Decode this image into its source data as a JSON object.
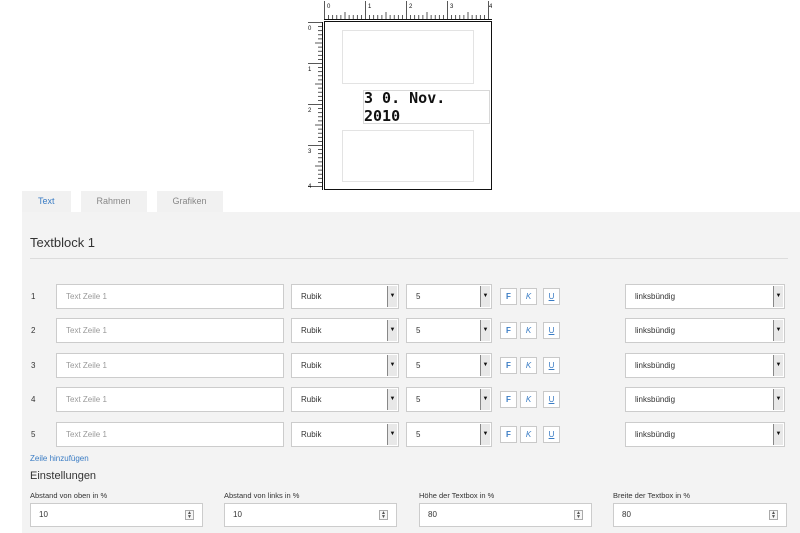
{
  "preview": {
    "ruler_top_labels": [
      "0",
      "1",
      "2",
      "3",
      "4"
    ],
    "ruler_left_labels": [
      "0",
      "1",
      "2",
      "3",
      "4"
    ],
    "stamp_text": "3 0. Nov. 2010"
  },
  "tabs": [
    {
      "label": "Text",
      "active": true
    },
    {
      "label": "Rahmen",
      "active": false
    },
    {
      "label": "Grafiken",
      "active": false
    }
  ],
  "textblock": {
    "title": "Textblock 1",
    "rows": [
      {
        "num": "1",
        "placeholder": "Text Zeile 1",
        "font": "Rubik",
        "size": "5",
        "bold": "F",
        "italic": "K",
        "underline": "U",
        "align": "linksbündig"
      },
      {
        "num": "2",
        "placeholder": "Text Zeile 1",
        "font": "Rubik",
        "size": "5",
        "bold": "F",
        "italic": "K",
        "underline": "U",
        "align": "linksbündig"
      },
      {
        "num": "3",
        "placeholder": "Text Zeile 1",
        "font": "Rubik",
        "size": "5",
        "bold": "F",
        "italic": "K",
        "underline": "U",
        "align": "linksbündig"
      },
      {
        "num": "4",
        "placeholder": "Text Zeile 1",
        "font": "Rubik",
        "size": "5",
        "bold": "F",
        "italic": "K",
        "underline": "U",
        "align": "linksbündig"
      },
      {
        "num": "5",
        "placeholder": "Text Zeile 1",
        "font": "Rubik",
        "size": "5",
        "bold": "F",
        "italic": "K",
        "underline": "U",
        "align": "linksbündig"
      }
    ],
    "add_line_label": "Zeile hinzufügen"
  },
  "settings": {
    "title": "Einstellungen",
    "fields": [
      {
        "label": "Abstand von oben in %",
        "value": "10"
      },
      {
        "label": "Abstand von links in %",
        "value": "10"
      },
      {
        "label": "Höhe der Textbox in %",
        "value": "80"
      },
      {
        "label": "Breite der Textbox in %",
        "value": "80"
      }
    ]
  },
  "colors": {
    "accent": "#3a7cc4",
    "panel_bg": "#f3f3f3"
  }
}
